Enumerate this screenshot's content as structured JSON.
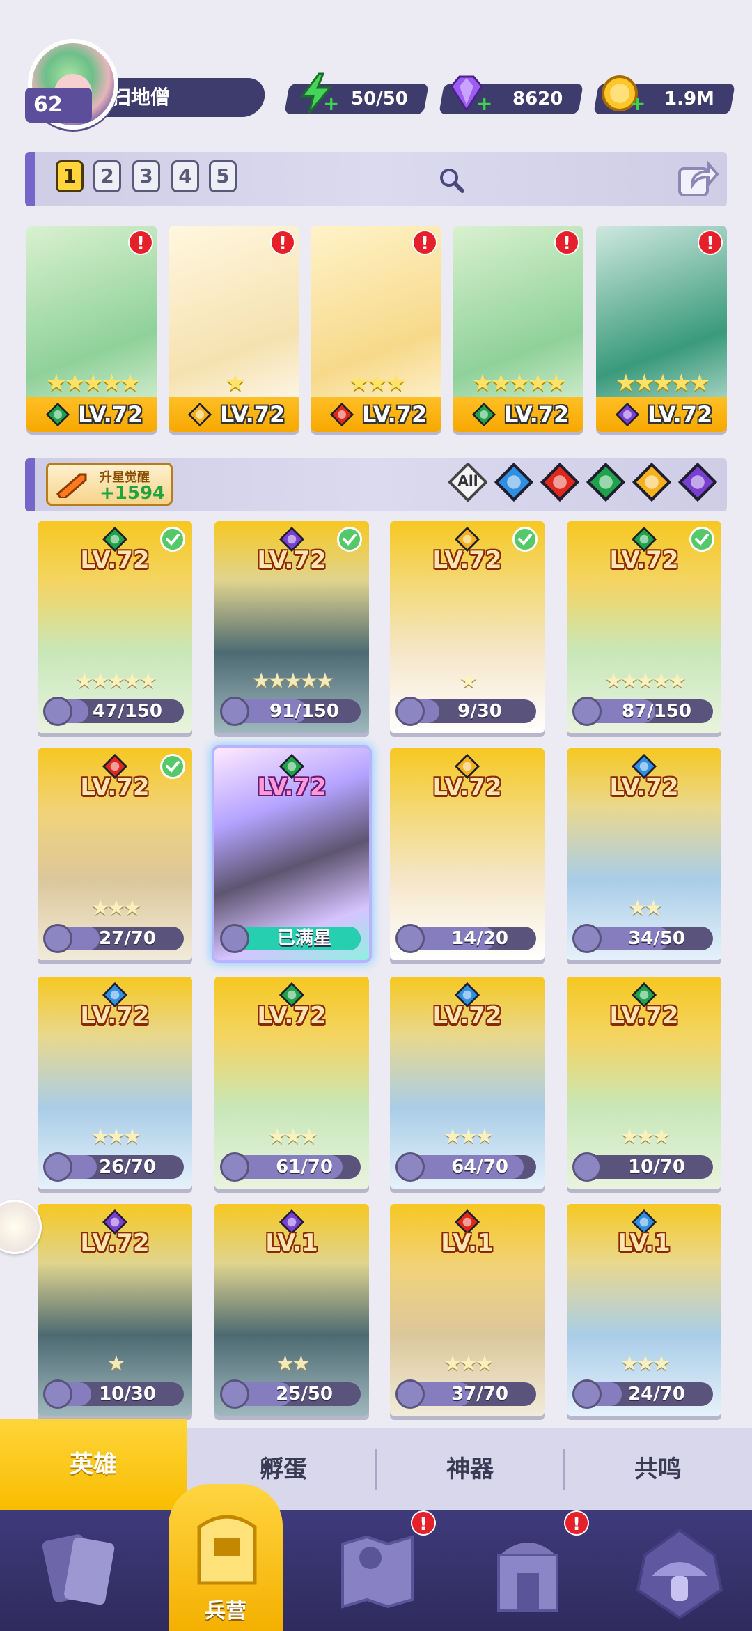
{
  "player": {
    "level": "62",
    "name": "扫地僧"
  },
  "resources": [
    {
      "name": "energy",
      "icon": "lightning-icon",
      "value": "50/50"
    },
    {
      "name": "gems",
      "icon": "gem-icon",
      "value": "8620"
    },
    {
      "name": "gold",
      "icon": "coin-icon",
      "value": "1.9M"
    }
  ],
  "teams": [
    "1",
    "2",
    "3",
    "4",
    "5"
  ],
  "active_team": "1",
  "team_slots": [
    {
      "level": "LV.72",
      "element": "nature",
      "stars": "★★★★★",
      "alert": "!"
    },
    {
      "level": "LV.72",
      "element": "light",
      "stars": "★",
      "alert": "!"
    },
    {
      "level": "LV.72",
      "element": "fire",
      "stars": "★★★",
      "alert": "!"
    },
    {
      "level": "LV.72",
      "element": "nature",
      "stars": "★★★★★",
      "alert": "!"
    },
    {
      "level": "LV.72",
      "element": "dark",
      "stars": "★★★★★",
      "alert": "!"
    }
  ],
  "upgrade": {
    "label": "升星觉醒",
    "count": "+1594"
  },
  "filters": [
    "All",
    "water",
    "fire",
    "nature",
    "light",
    "dark"
  ],
  "filter_all_label": "All",
  "heroes": [
    {
      "level": "LV.72",
      "element": "nature",
      "checked": true,
      "progress": "47/150",
      "fill": 0.31,
      "stars": "★★★★★"
    },
    {
      "level": "LV.72",
      "element": "dark",
      "checked": true,
      "progress": "91/150",
      "fill": 0.61,
      "stars": "★★★★★"
    },
    {
      "level": "LV.72",
      "element": "light",
      "checked": true,
      "progress": "9/30",
      "fill": 0.3,
      "stars": "★"
    },
    {
      "level": "LV.72",
      "element": "nature",
      "checked": true,
      "progress": "87/150",
      "fill": 0.58,
      "stars": "★★★★★"
    },
    {
      "level": "LV.72",
      "element": "fire",
      "checked": true,
      "progress": "27/70",
      "fill": 0.39,
      "stars": "★★★"
    },
    {
      "level": "LV.72",
      "element": "nature",
      "checked": false,
      "progress": "已满星",
      "fill": 1.0,
      "stars": "",
      "special": true
    },
    {
      "level": "LV.72",
      "element": "light",
      "checked": false,
      "progress": "14/20",
      "fill": 0.7,
      "stars": ""
    },
    {
      "level": "LV.72",
      "element": "water",
      "checked": false,
      "progress": "34/50",
      "fill": 0.68,
      "stars": "★★"
    },
    {
      "level": "LV.72",
      "element": "water",
      "checked": false,
      "progress": "26/70",
      "fill": 0.37,
      "stars": "★★★"
    },
    {
      "level": "LV.72",
      "element": "nature",
      "checked": false,
      "progress": "61/70",
      "fill": 0.87,
      "stars": "★★★"
    },
    {
      "level": "LV.72",
      "element": "water",
      "checked": false,
      "progress": "64/70",
      "fill": 0.91,
      "stars": "★★★"
    },
    {
      "level": "LV.72",
      "element": "nature",
      "checked": false,
      "progress": "10/70",
      "fill": 0.14,
      "stars": "★★★"
    },
    {
      "level": "LV.72",
      "element": "dark",
      "checked": false,
      "progress": "10/30",
      "fill": 0.33,
      "stars": "★"
    },
    {
      "level": "LV.1",
      "element": "dark",
      "checked": false,
      "progress": "25/50",
      "fill": 0.5,
      "stars": "★★"
    },
    {
      "level": "LV.1",
      "element": "fire",
      "checked": false,
      "progress": "37/70",
      "fill": 0.53,
      "stars": "★★★"
    },
    {
      "level": "LV.1",
      "element": "water",
      "checked": false,
      "progress": "24/70",
      "fill": 0.34,
      "stars": "★★★"
    }
  ],
  "subtabs": [
    "英雄",
    "孵蛋",
    "神器",
    "共鸣"
  ],
  "active_subtab": "英雄",
  "nav": [
    {
      "name": "cards",
      "icon": "cards-icon",
      "label": ""
    },
    {
      "name": "barracks",
      "icon": "barracks-icon",
      "label": "兵营"
    },
    {
      "name": "map",
      "icon": "map-icon",
      "label": "",
      "alert": "!"
    },
    {
      "name": "temple",
      "icon": "temple-icon",
      "label": "",
      "alert": "!"
    },
    {
      "name": "summon",
      "icon": "mushroom-icon",
      "label": ""
    }
  ],
  "colors": {
    "water": "#2f8fe0",
    "fire": "#e0271b",
    "nature": "#1fa34a",
    "light": "#f5b21c",
    "dark": "#7a3fd1",
    "card_top": "#f5c21f",
    "accent_purple": "#7766c9",
    "alert_red": "#e5202a"
  }
}
